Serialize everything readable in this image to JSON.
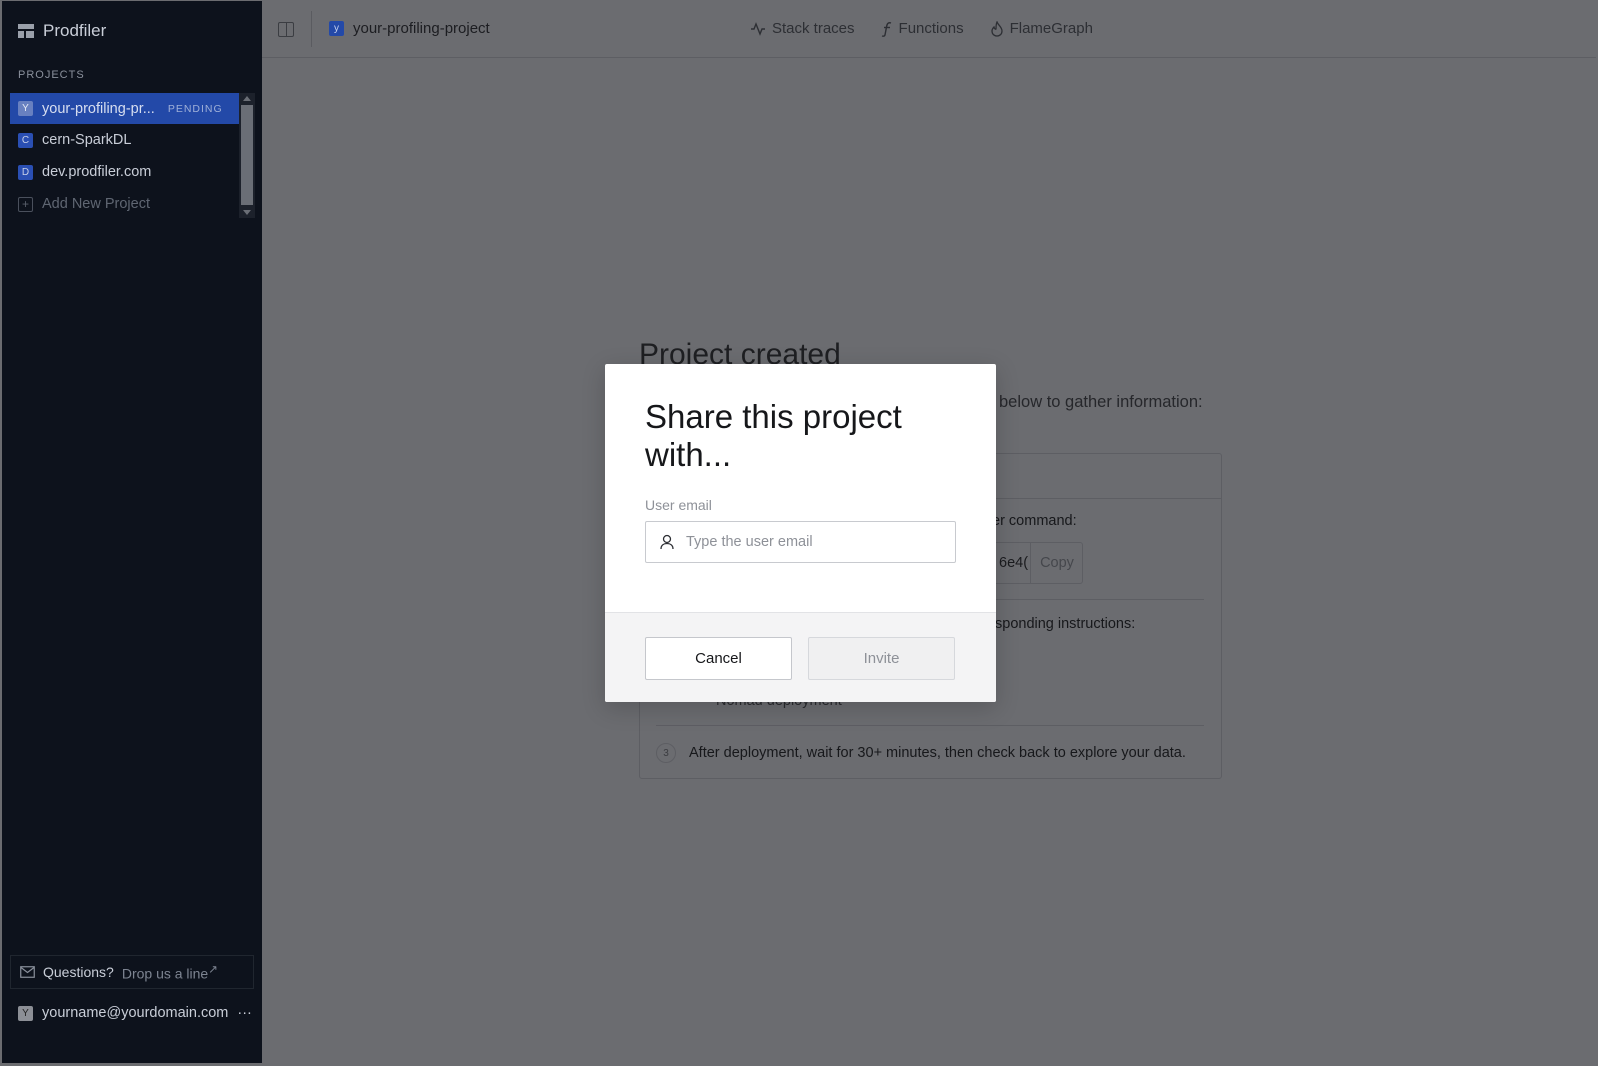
{
  "app": {
    "name": "Prodfiler"
  },
  "sidebar": {
    "section_label": "PROJECTS",
    "projects": [
      {
        "initial": "Y",
        "name": "your-profiling-pr...",
        "status": "PENDING"
      },
      {
        "initial": "C",
        "name": "cern-SparkDL"
      },
      {
        "initial": "D",
        "name": "dev.prodfiler.com"
      }
    ],
    "add_project": "Add New Project",
    "questions": {
      "label": "Questions?",
      "link": "Drop us a line",
      "link_icon": "↗"
    },
    "user": {
      "initial": "Y",
      "email": "yourname@yourdomain.com",
      "more": "···"
    }
  },
  "topbar": {
    "project": {
      "initial": "y",
      "name": "your-profiling-project"
    },
    "nav": [
      {
        "icon": "activity-icon",
        "label": "Stack traces"
      },
      {
        "icon": "function-icon",
        "label": "Functions"
      },
      {
        "icon": "flame-icon",
        "label": "FlameGraph"
      }
    ]
  },
  "background": {
    "title": "Project created",
    "description": "below to gather information:",
    "step1_text": "er command:",
    "command_value": "6e4(",
    "copy_label": "Copy",
    "step2_text": "sponding instructions:",
    "deployment_option": "Nomad deployment",
    "step3_num": "3",
    "step3_text": "After deployment, wait for 30+ minutes, then check back to explore your data."
  },
  "modal": {
    "title": "Share this project with...",
    "field_label": "User email",
    "email_value": "",
    "email_placeholder": "Type the user email",
    "cancel_label": "Cancel",
    "invite_label": "Invite"
  },
  "colors": {
    "sidebar_bg": "#0d121c",
    "active_project": "#2349a8",
    "overlay": "#6b6c70",
    "modal_bg": "#ffffff"
  }
}
